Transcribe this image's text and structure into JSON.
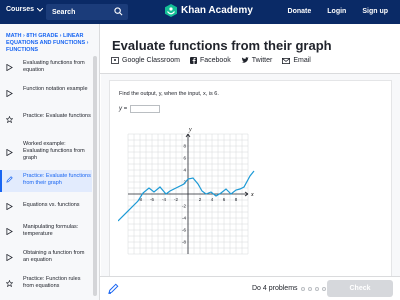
{
  "topbar": {
    "courses": "Courses",
    "search": "Search",
    "brand": "Khan Academy",
    "links": [
      "Donate",
      "Login",
      "Sign up"
    ]
  },
  "sidebar": {
    "breadcrumb": "MATH › 8TH GRADE › LINEAR EQUATIONS AND FUNCTIONS › FUNCTIONS",
    "items": [
      {
        "label": "Evaluating functions from equation",
        "icon": "play-icon"
      },
      {
        "label": "Function notation example",
        "icon": "play-icon"
      },
      {
        "label": "Practice: Evaluate functions",
        "icon": "star-icon"
      },
      {
        "label": "Worked example: Evaluating functions from graph",
        "icon": "play-icon"
      },
      {
        "label": "Practice: Evaluate functions from their graph",
        "icon": "pencil-icon",
        "active": true
      },
      {
        "label": "Equations vs. functions",
        "icon": "play-icon"
      },
      {
        "label": "Manipulating formulas: temperature",
        "icon": "play-icon"
      },
      {
        "label": "Obtaining a function from an equation",
        "icon": "play-icon"
      },
      {
        "label": "Practice: Function rules from equations",
        "icon": "star-icon"
      }
    ]
  },
  "main": {
    "title": "Evaluate functions from their graph",
    "share": [
      "Google Classroom",
      "Facebook",
      "Twitter",
      "Email"
    ],
    "question": "Find the output, y, when the input, x, is 6.",
    "answer_label": "y =",
    "answer_value": ""
  },
  "graph": {
    "x_label": "x",
    "y_label": "y",
    "ticks_x": [
      "-8",
      "-6",
      "-4",
      "-2",
      "2",
      "4",
      "6",
      "8"
    ],
    "ticks_y": [
      "8",
      "6",
      "4",
      "2",
      "-2",
      "-4",
      "-6",
      "-8"
    ],
    "curve_color": "#1c9ad6"
  },
  "bottombar": {
    "progress": "Do 4 problems",
    "check": "Check"
  },
  "colors": {
    "topbar": "#0a2a66",
    "accent": "#1865f2"
  }
}
